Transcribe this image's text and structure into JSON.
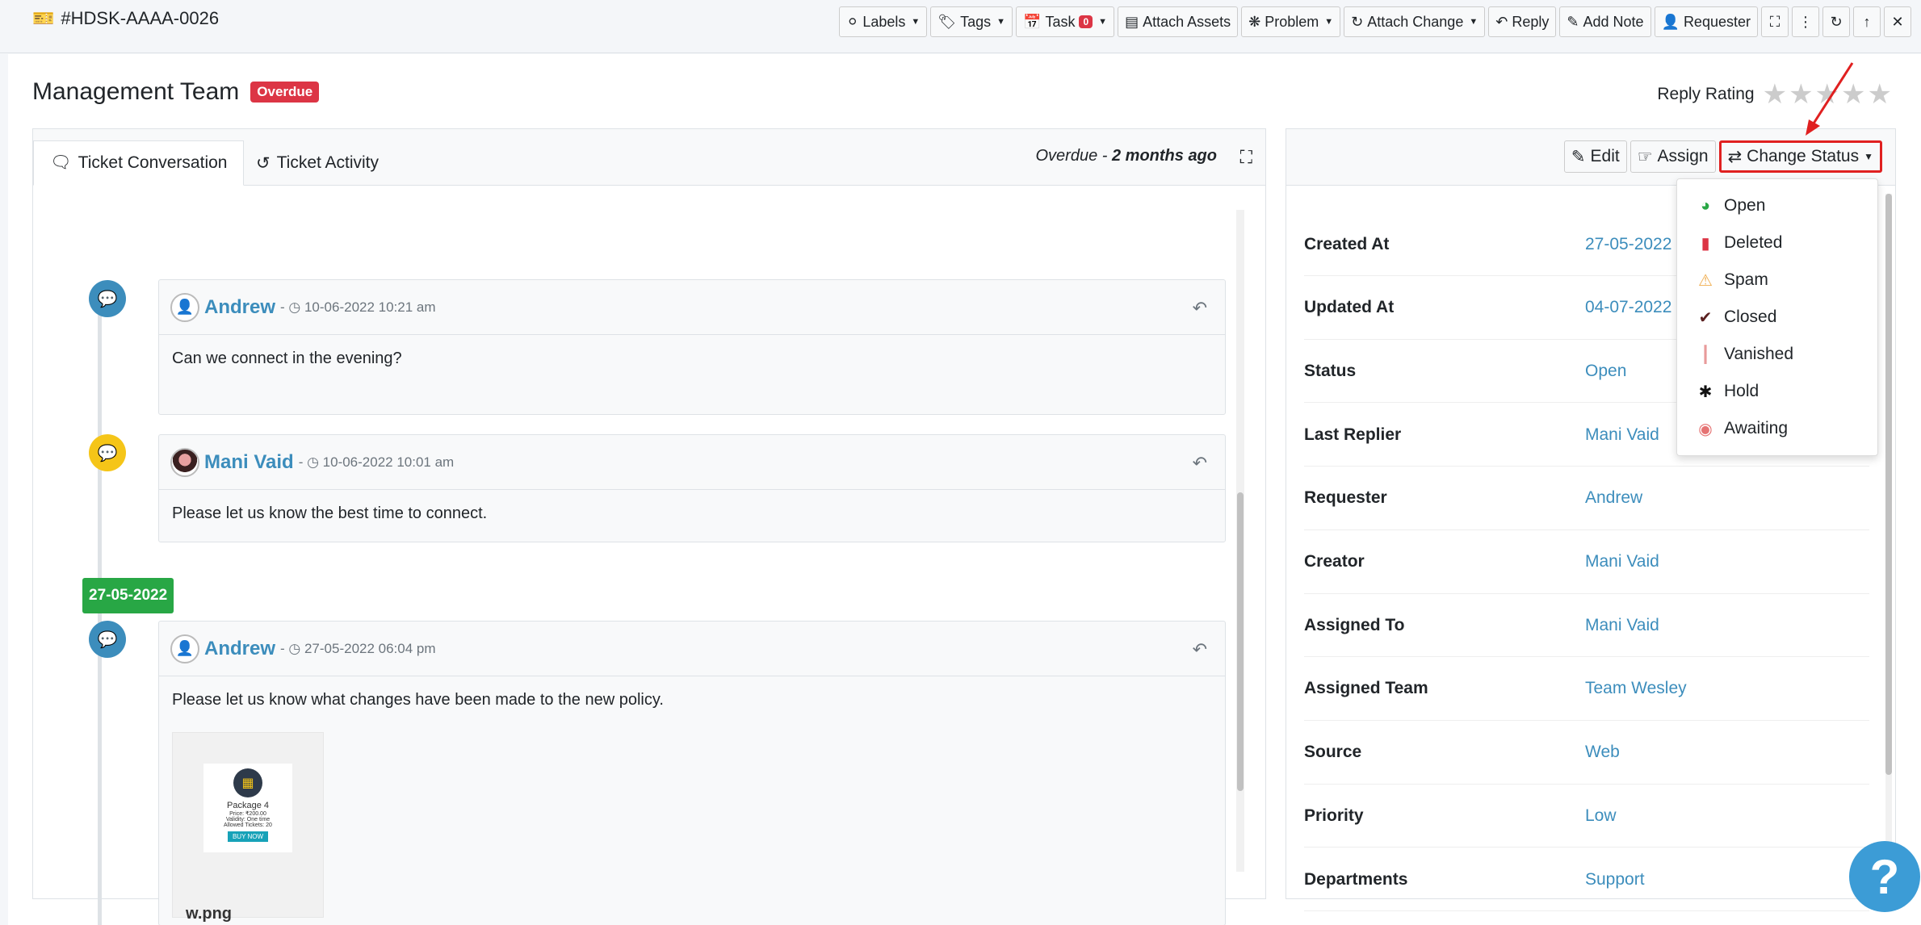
{
  "header": {
    "ticket_id": "#HDSK-AAAA-0026",
    "toolbar": {
      "labels": "Labels",
      "tags": "Tags",
      "task": "Task",
      "task_count": "0",
      "attach_assets": "Attach Assets",
      "problem": "Problem",
      "attach_change": "Attach Change",
      "reply": "Reply",
      "add_note": "Add Note",
      "requester": "Requester"
    }
  },
  "ticket": {
    "title": "Management Team",
    "status_badge": "Overdue",
    "reply_rating_label": "Reply Rating",
    "rating": 0,
    "max_rating": 5
  },
  "conversation": {
    "tabs": [
      "Ticket Conversation",
      "Ticket Activity"
    ],
    "overdue_prefix": "Overdue - ",
    "overdue_time": "2 months ago",
    "date_separator": "27-05-2022",
    "messages": [
      {
        "author": "Andrew",
        "timestamp": "10-06-2022 10:21 am",
        "body": "Can we connect in the evening?"
      },
      {
        "author": "Mani Vaid",
        "timestamp": "10-06-2022 10:01 am",
        "body": "Please let us know the best time to connect."
      },
      {
        "author": "Andrew",
        "timestamp": "27-05-2022 06:04 pm",
        "body": "Please let us know what changes have been made to the new policy."
      }
    ],
    "attachment": {
      "filename": "w.png",
      "thumb_title": "Package 4",
      "thumb_price": "Price: ₹200.00",
      "thumb_validity": "Validity: One time",
      "thumb_tickets": "Allowed Tickets: 20",
      "thumb_button": "BUY NOW"
    }
  },
  "details": {
    "buttons": {
      "edit": "Edit",
      "assign": "Assign",
      "change_status": "Change Status"
    },
    "rows": [
      {
        "label": "Created At",
        "value": "27-05-2022"
      },
      {
        "label": "Updated At",
        "value": "04-07-2022"
      },
      {
        "label": "Status",
        "value": "Open"
      },
      {
        "label": "Last Replier",
        "value": "Mani Vaid"
      },
      {
        "label": "Requester",
        "value": "Andrew"
      },
      {
        "label": "Creator",
        "value": "Mani Vaid"
      },
      {
        "label": "Assigned To",
        "value": "Mani Vaid"
      },
      {
        "label": "Assigned Team",
        "value": "Team Wesley"
      },
      {
        "label": "Source",
        "value": "Web"
      },
      {
        "label": "Priority",
        "value": "Low"
      },
      {
        "label": "Departments",
        "value": "Support"
      }
    ]
  },
  "status_dropdown": {
    "items": [
      {
        "label": "Open",
        "icon": "clock-icon",
        "color": "#28a745"
      },
      {
        "label": "Deleted",
        "icon": "trash-icon",
        "color": "#dc3545"
      },
      {
        "label": "Spam",
        "icon": "warning-icon",
        "color": "#f0ad4e"
      },
      {
        "label": "Closed",
        "icon": "check-icon",
        "color": "#5a2020"
      },
      {
        "label": "Vanished",
        "icon": "barcode-icon",
        "color": "#e89a9a"
      },
      {
        "label": "Hold",
        "icon": "asterisk-icon",
        "color": "#111111"
      },
      {
        "label": "Awaiting",
        "icon": "circle-dot-icon",
        "color": "#e57373"
      }
    ]
  },
  "help": {
    "symbol": "?"
  }
}
